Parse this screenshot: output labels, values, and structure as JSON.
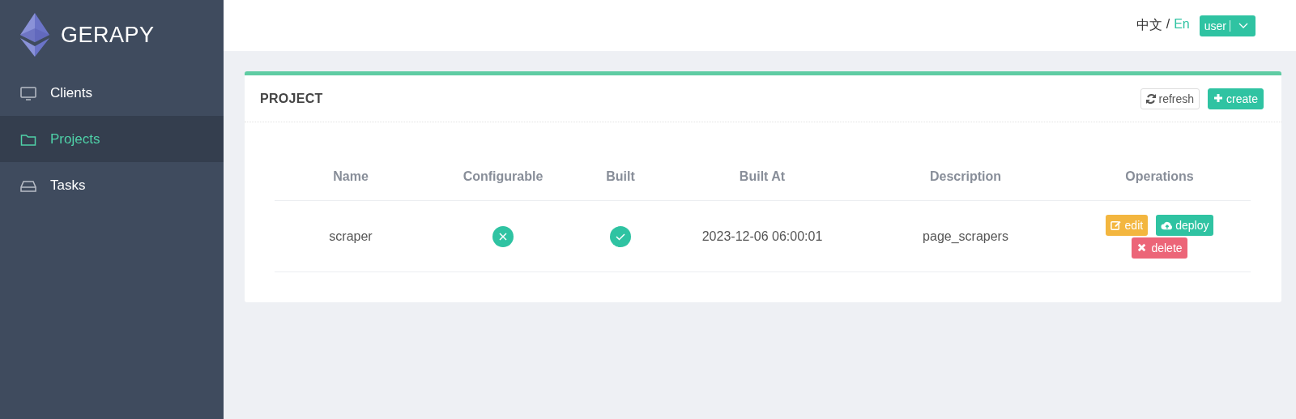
{
  "sidebar": {
    "brand": "GERAPY",
    "items": [
      {
        "label": "Clients",
        "kind": "monitor",
        "selected": false
      },
      {
        "label": "Projects",
        "kind": "folder",
        "selected": true
      },
      {
        "label": "Tasks",
        "kind": "drive",
        "selected": false
      }
    ]
  },
  "header": {
    "languages": [
      {
        "label": "中文",
        "selected": false
      },
      {
        "label": "En",
        "selected": true
      }
    ],
    "separator": "/",
    "user": "user"
  },
  "panel": {
    "title": "PROJECT",
    "buttons": [
      {
        "label": "refresh",
        "kind": "plain"
      },
      {
        "label": "create",
        "kind": "primary"
      }
    ],
    "table": {
      "columns": [
        "Name",
        "Configurable",
        "Built",
        "Built At",
        "Description",
        "Operations"
      ],
      "rows": [
        {
          "name": "scraper",
          "configurable": false,
          "built": true,
          "built_at": "2023-12-06 06:00:01",
          "description": "page_scrapers",
          "operations": [
            {
              "label": "edit",
              "kind": "edit"
            },
            {
              "label": "deploy",
              "kind": "deploy"
            },
            {
              "label": "delete",
              "kind": "delete"
            }
          ]
        }
      ]
    }
  }
}
